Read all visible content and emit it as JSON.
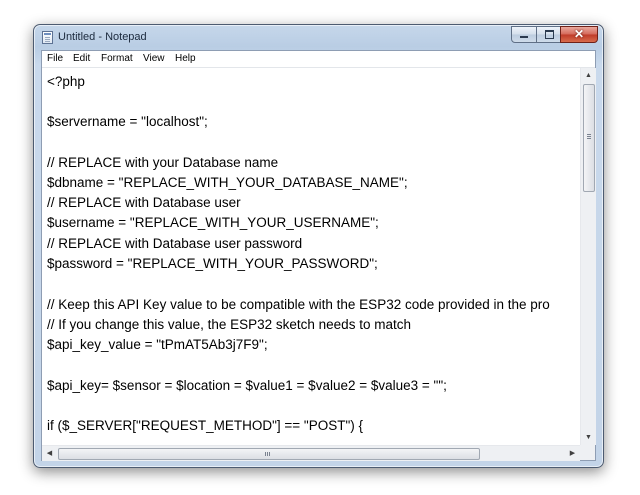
{
  "window": {
    "title": "Untitled - Notepad",
    "close_symbol": "✕"
  },
  "menu": {
    "items": [
      "File",
      "Edit",
      "Format",
      "View",
      "Help"
    ]
  },
  "editor": {
    "lines": [
      "<?php",
      "",
      "$servername = \"localhost\";",
      "",
      "// REPLACE with your Database name",
      "$dbname = \"REPLACE_WITH_YOUR_DATABASE_NAME\";",
      "// REPLACE with Database user",
      "$username = \"REPLACE_WITH_YOUR_USERNAME\";",
      "// REPLACE with Database user password",
      "$password = \"REPLACE_WITH_YOUR_PASSWORD\";",
      "",
      "// Keep this API Key value to be compatible with the ESP32 code provided in the pro",
      "// If you change this value, the ESP32 sketch needs to match",
      "$api_key_value = \"tPmAT5Ab3j7F9\";",
      "",
      "$api_key= $sensor = $location = $value1 = $value2 = $value3 = \"\";",
      "",
      "if ($_SERVER[\"REQUEST_METHOD\"] == \"POST\") {"
    ]
  },
  "scrollbars": {
    "up_arrow": "▲",
    "down_arrow": "▼",
    "left_arrow": "◀",
    "right_arrow": "▶"
  }
}
